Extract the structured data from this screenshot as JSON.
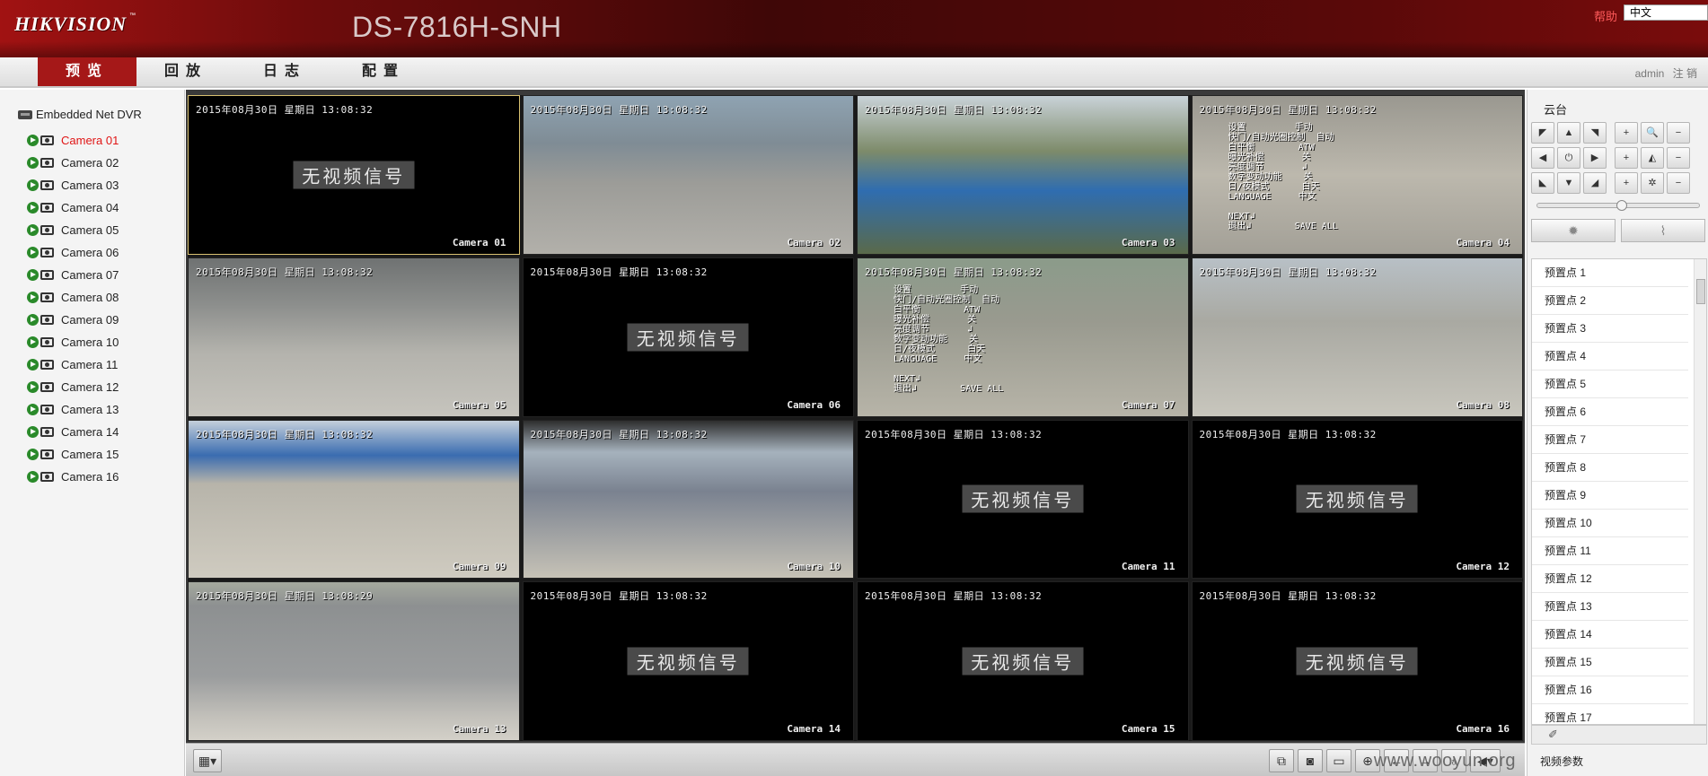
{
  "header": {
    "logo": "HIKVISION",
    "logo_tm": "™",
    "model": "DS-7816H-SNH",
    "help": "帮助",
    "language": "中文"
  },
  "nav": {
    "tabs": [
      {
        "label": "预览",
        "active": true
      },
      {
        "label": "回放",
        "active": false
      },
      {
        "label": "日志",
        "active": false
      },
      {
        "label": "配置",
        "active": false
      }
    ],
    "user": "admin",
    "logout": "注 销"
  },
  "sidebar": {
    "root": "Embedded Net DVR",
    "cameras": [
      {
        "label": "Camera 01",
        "active": true
      },
      {
        "label": "Camera 02"
      },
      {
        "label": "Camera 03"
      },
      {
        "label": "Camera 04"
      },
      {
        "label": "Camera 05"
      },
      {
        "label": "Camera 06"
      },
      {
        "label": "Camera 07"
      },
      {
        "label": "Camera 08"
      },
      {
        "label": "Camera 09"
      },
      {
        "label": "Camera 10"
      },
      {
        "label": "Camera 11"
      },
      {
        "label": "Camera 12"
      },
      {
        "label": "Camera 13"
      },
      {
        "label": "Camera 14"
      },
      {
        "label": "Camera 15"
      },
      {
        "label": "Camera 16"
      }
    ]
  },
  "grid": {
    "no_signal_text": "无视频信号",
    "tiles": [
      {
        "timestamp": "2015年08月30日 星期日 13:08:32",
        "name": "Camera 01",
        "no_signal": true,
        "scene": "none"
      },
      {
        "timestamp": "2015年08月30日 星期日 13:08:32",
        "name": "Camera 02",
        "no_signal": false,
        "scene": "gate"
      },
      {
        "timestamp": "2015年08月30日 星期日 13:08:32",
        "name": "Camera 03",
        "no_signal": false,
        "scene": "tarp"
      },
      {
        "timestamp": "2015年08月30日 星期日 13:08:32",
        "name": "Camera 04",
        "no_signal": false,
        "scene": "yard-menu"
      },
      {
        "timestamp": "2015年08月30日 星期日 13:08:32",
        "name": "Camera 05",
        "no_signal": false,
        "scene": "lot"
      },
      {
        "timestamp": "2015年08月30日 星期日 13:08:32",
        "name": "Camera 06",
        "no_signal": true,
        "scene": "none"
      },
      {
        "timestamp": "2015年08月30日 星期日 13:08:32",
        "name": "Camera 07",
        "no_signal": false,
        "scene": "loader-menu"
      },
      {
        "timestamp": "2015年08月30日 星期日 13:08:32",
        "name": "Camera 08",
        "no_signal": false,
        "scene": "stairs"
      },
      {
        "timestamp": "2015年08月30日 星期日 13:08:32",
        "name": "Camera 09",
        "no_signal": false,
        "scene": "fence-yard"
      },
      {
        "timestamp": "2015年08月30日 星期日 13:08:32",
        "name": "Camera 10",
        "no_signal": false,
        "scene": "fisheye"
      },
      {
        "timestamp": "2015年08月30日 星期日 13:08:32",
        "name": "Camera 11",
        "no_signal": true,
        "scene": "none"
      },
      {
        "timestamp": "2015年08月30日 星期日 13:08:32",
        "name": "Camera 12",
        "no_signal": true,
        "scene": "none"
      },
      {
        "timestamp": "2015年08月30日 星期日 13:08:29",
        "name": "Camera 13",
        "no_signal": false,
        "scene": "wall"
      },
      {
        "timestamp": "2015年08月30日 星期日 13:08:32",
        "name": "Camera 14",
        "no_signal": true,
        "scene": "none"
      },
      {
        "timestamp": "2015年08月30日 星期日 13:08:32",
        "name": "Camera 15",
        "no_signal": true,
        "scene": "none"
      },
      {
        "timestamp": "2015年08月30日 星期日 13:08:32",
        "name": "Camera 16",
        "no_signal": true,
        "scene": "none"
      }
    ],
    "osd_menu_04": "设置         手动\n快门/自动光圈控制  自动\n白平衡        ATW\n曝光补偿       关\n亮度调节       ↲\n数字变动功能    关\n日/夜模式      白天\nLANGUAGE     中文\n\nNEXT↲\n退出↲        SAVE ALL",
    "osd_menu_07": "设置         手动\n快门/自动光圈控制  自动\n白平衡        ATW\n曝光补偿       关\n亮度调节       ↲\n数字变动功能    关\n日/夜模式      白天\nLANGUAGE     中文\n\nNEXT↲\n退出↲        SAVE ALL"
  },
  "toolbar": {
    "layout_icon": "grid-layout-icon",
    "watermark": "www.wooyun.org"
  },
  "ptz": {
    "title": "云台",
    "presets": [
      "预置点 1",
      "预置点 2",
      "预置点 3",
      "预置点 4",
      "预置点 5",
      "预置点 6",
      "预置点 7",
      "预置点 8",
      "预置点 9",
      "预置点 10",
      "预置点 11",
      "预置点 12",
      "预置点 13",
      "预置点 14",
      "预置点 15",
      "预置点 16",
      "预置点 17"
    ],
    "video_params": "视频参数"
  }
}
